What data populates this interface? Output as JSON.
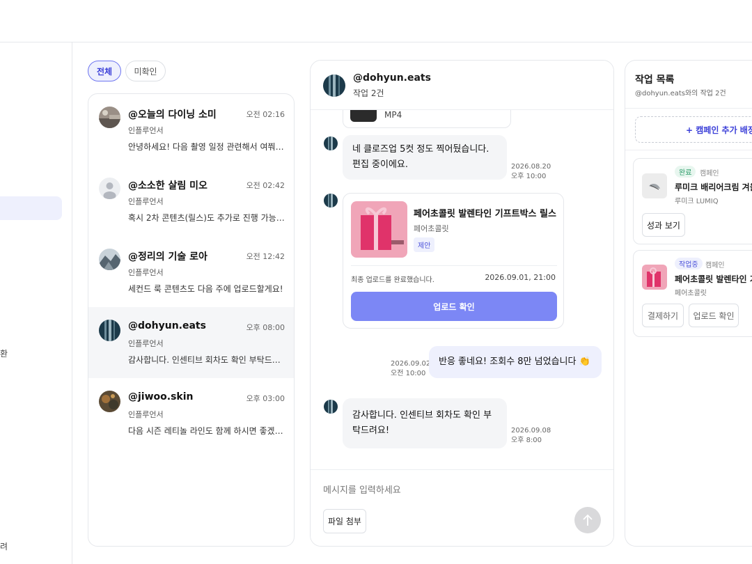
{
  "filters": {
    "all": "전체",
    "unread": "미확인"
  },
  "sidebar": {
    "fragment_1": "환",
    "fragment_2": "려"
  },
  "conversations": [
    {
      "name": "@오늘의 다이닝 소미",
      "time": "오전 02:16",
      "role": "인플루언서",
      "preview": "안녕하세요! 다음 촬영 일정 관련해서 여쭤볼..."
    },
    {
      "name": "@소소한 살림 미오",
      "time": "오전 02:42",
      "role": "인플루언서",
      "preview": "혹시 2차 콘텐츠(릴스)도 추가로 진행 가능할..."
    },
    {
      "name": "@정리의 기술 로아",
      "time": "오전 12:42",
      "role": "인플루언서",
      "preview": "세컨드 룩 콘텐츠도 다음 주에 업로드할게요!"
    },
    {
      "name": "@dohyun.eats",
      "time": "오후 08:00",
      "role": "인플루언서",
      "preview": "감사합니다. 인센티브 회차도 확인 부탁드려요!"
    },
    {
      "name": "@jiwoo.skin",
      "time": "오후 03:00",
      "role": "인플루언서",
      "preview": "다음 시즌 레티놀 라인도 함께 하시면 좋겠어..."
    }
  ],
  "chat": {
    "handle": "@dohyun.eats",
    "subtitle": "작업 2건",
    "file_type": "MP4",
    "messages": [
      {
        "line1": "네 클로즈업 5컷 정도 찍어뒀습니다.",
        "line2": "편집 중이에요.",
        "date": "2026.08.20",
        "time": "오후 10:00"
      },
      {
        "text": "반응 좋네요! 조회수 8만 넘었습니다 👏",
        "date": "2026.09.02",
        "time": "오전 10:00"
      },
      {
        "line1": "감사합니다. 인센티브 회차도 확인 부",
        "line2": "탁드려요!",
        "date": "2026.09.08",
        "time": "오후 8:00"
      }
    ],
    "offer": {
      "title": "페어초콜릿 발렌타인 기프트박스 릴스",
      "brand": "페어초콜릿",
      "tag": "제안",
      "status": "최종 업로드를 완료했습니다.",
      "status_date": "2026.09.01, 21:00",
      "cta": "업로드 확인"
    },
    "composer": {
      "placeholder": "메시지를 입력하세요",
      "attach": "파일 첨부"
    }
  },
  "tasks": {
    "title": "작업 목록",
    "subtitle": "@dohyun.eats와의 작업 2건",
    "add_button": "+ 캠페인 추가 배정",
    "items": [
      {
        "status": "완료",
        "kind": "캠페인",
        "name": "루미크 배리어크림 겨울",
        "brand": "루미크 LUMIQ",
        "btn1": "성과 보기"
      },
      {
        "status": "작업중",
        "kind": "캠페인",
        "name": "페어초콜릿 발렌타인 기",
        "brand": "페어초콜릿",
        "btn1": "결제하기",
        "btn2": "업로드 확인"
      }
    ]
  },
  "colors": {
    "accent": "#7c87f5",
    "accent_text": "#3b3fd8",
    "accent_bg": "#eef0fd",
    "done_green": "#2f9e6b"
  }
}
